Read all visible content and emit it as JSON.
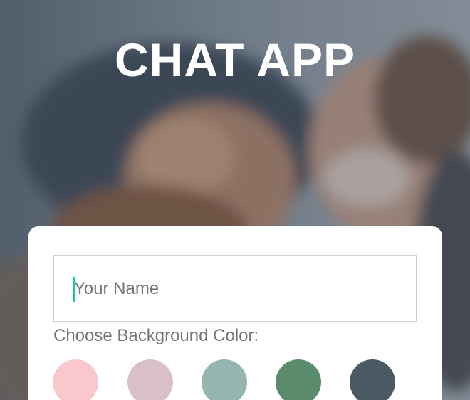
{
  "app": {
    "title": "CHAT APP"
  },
  "form": {
    "name_placeholder": "Your Name",
    "name_value": "",
    "color_label": "Choose Background Color:"
  },
  "colors": {
    "swatch_1": "#f9c8cc",
    "swatch_2": "#d9bfc8",
    "swatch_3": "#95b5ae",
    "swatch_4": "#5a8b6d",
    "swatch_5": "#4a5a62",
    "caret": "#19c7a8"
  }
}
